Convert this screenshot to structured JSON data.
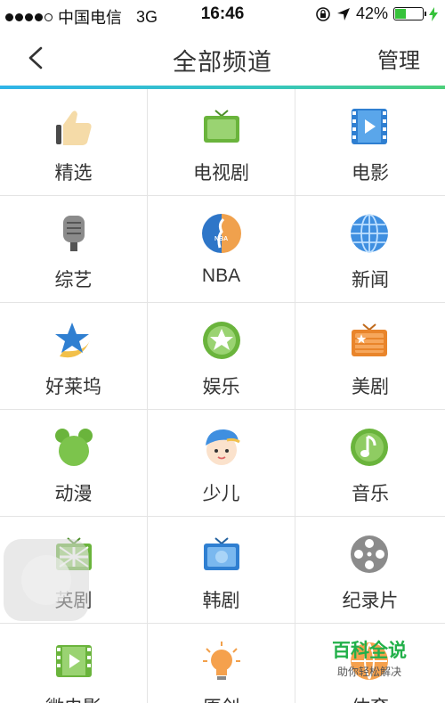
{
  "status": {
    "carrier": "中国电信",
    "network": "3G",
    "time": "16:46",
    "battery": "42%",
    "battery_level": 0.42
  },
  "nav": {
    "title": "全部频道",
    "manage": "管理"
  },
  "channels": [
    {
      "label": "精选",
      "icon": "thumbs-up-icon"
    },
    {
      "label": "电视剧",
      "icon": "tv-icon"
    },
    {
      "label": "电影",
      "icon": "film-icon"
    },
    {
      "label": "综艺",
      "icon": "microphone-icon"
    },
    {
      "label": "NBA",
      "icon": "nba-icon"
    },
    {
      "label": "新闻",
      "icon": "globe-icon"
    },
    {
      "label": "好莱坞",
      "icon": "star-moon-icon"
    },
    {
      "label": "娱乐",
      "icon": "star-badge-icon"
    },
    {
      "label": "美剧",
      "icon": "us-tv-icon"
    },
    {
      "label": "动漫",
      "icon": "cartoon-bear-icon"
    },
    {
      "label": "少儿",
      "icon": "kid-face-icon"
    },
    {
      "label": "音乐",
      "icon": "music-note-icon"
    },
    {
      "label": "英剧",
      "icon": "uk-tv-icon"
    },
    {
      "label": "韩剧",
      "icon": "korean-tv-icon"
    },
    {
      "label": "纪录片",
      "icon": "film-reel-icon"
    },
    {
      "label": "微电影",
      "icon": "micro-film-icon"
    },
    {
      "label": "原创",
      "icon": "lightbulb-icon"
    },
    {
      "label": "体育",
      "icon": "sports-icon"
    }
  ],
  "watermark": {
    "title": "百科全说",
    "subtitle": "助你轻松解决"
  }
}
